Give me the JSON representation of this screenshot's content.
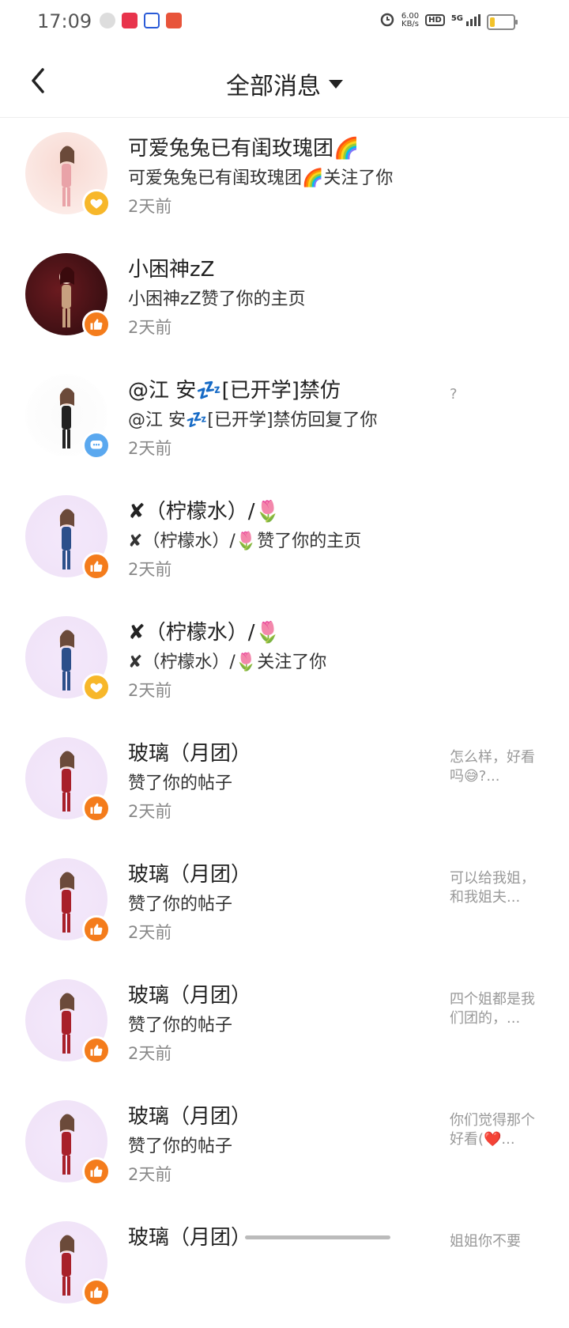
{
  "status_bar": {
    "time": "17:09",
    "speed_value": "6.00",
    "speed_unit": "KB/s",
    "hd": "HD",
    "network": "5G"
  },
  "header": {
    "title": "全部消息"
  },
  "messages": [
    {
      "name": "可爱兔兔已有闺玫瑰团🌈",
      "desc": "可爱兔兔已有闺玫瑰团🌈关注了你",
      "time": "2天前",
      "badge": "heart-icon",
      "preview": ""
    },
    {
      "name": "小困神zZ",
      "desc": "小困神zZ赞了你的主页",
      "time": "2天前",
      "badge": "thumbs-up-icon",
      "preview": ""
    },
    {
      "name": "@江 安💤[已开学]禁仿",
      "desc": "@江 安💤[已开学]禁仿回复了你",
      "time": "2天前",
      "badge": "comment-icon",
      "preview": "?"
    },
    {
      "name": "✘（柠檬水）/🌷",
      "desc": "✘（柠檬水）/🌷赞了你的主页",
      "time": "2天前",
      "badge": "thumbs-up-icon",
      "preview": ""
    },
    {
      "name": "✘（柠檬水）/🌷",
      "desc": "✘（柠檬水）/🌷关注了你",
      "time": "2天前",
      "badge": "heart-icon",
      "preview": ""
    },
    {
      "name": "玻璃（月团）",
      "desc": "赞了你的帖子",
      "time": "2天前",
      "badge": "thumbs-up-icon",
      "preview": "怎么样，好看吗😅?..."
    },
    {
      "name": "玻璃（月团）",
      "desc": "赞了你的帖子",
      "time": "2天前",
      "badge": "thumbs-up-icon",
      "preview": "可以给我姐，和我姐夫..."
    },
    {
      "name": "玻璃（月团）",
      "desc": "赞了你的帖子",
      "time": "2天前",
      "badge": "thumbs-up-icon",
      "preview": "四个姐都是我们团的，..."
    },
    {
      "name": "玻璃（月团）",
      "desc": "赞了你的帖子",
      "time": "2天前",
      "badge": "thumbs-up-icon",
      "preview": "你们觉得那个好看(❤️..."
    },
    {
      "name": "玻璃（月团）",
      "desc": "",
      "time": "",
      "badge": "thumbs-up-icon",
      "preview": "姐姐你不要"
    }
  ]
}
